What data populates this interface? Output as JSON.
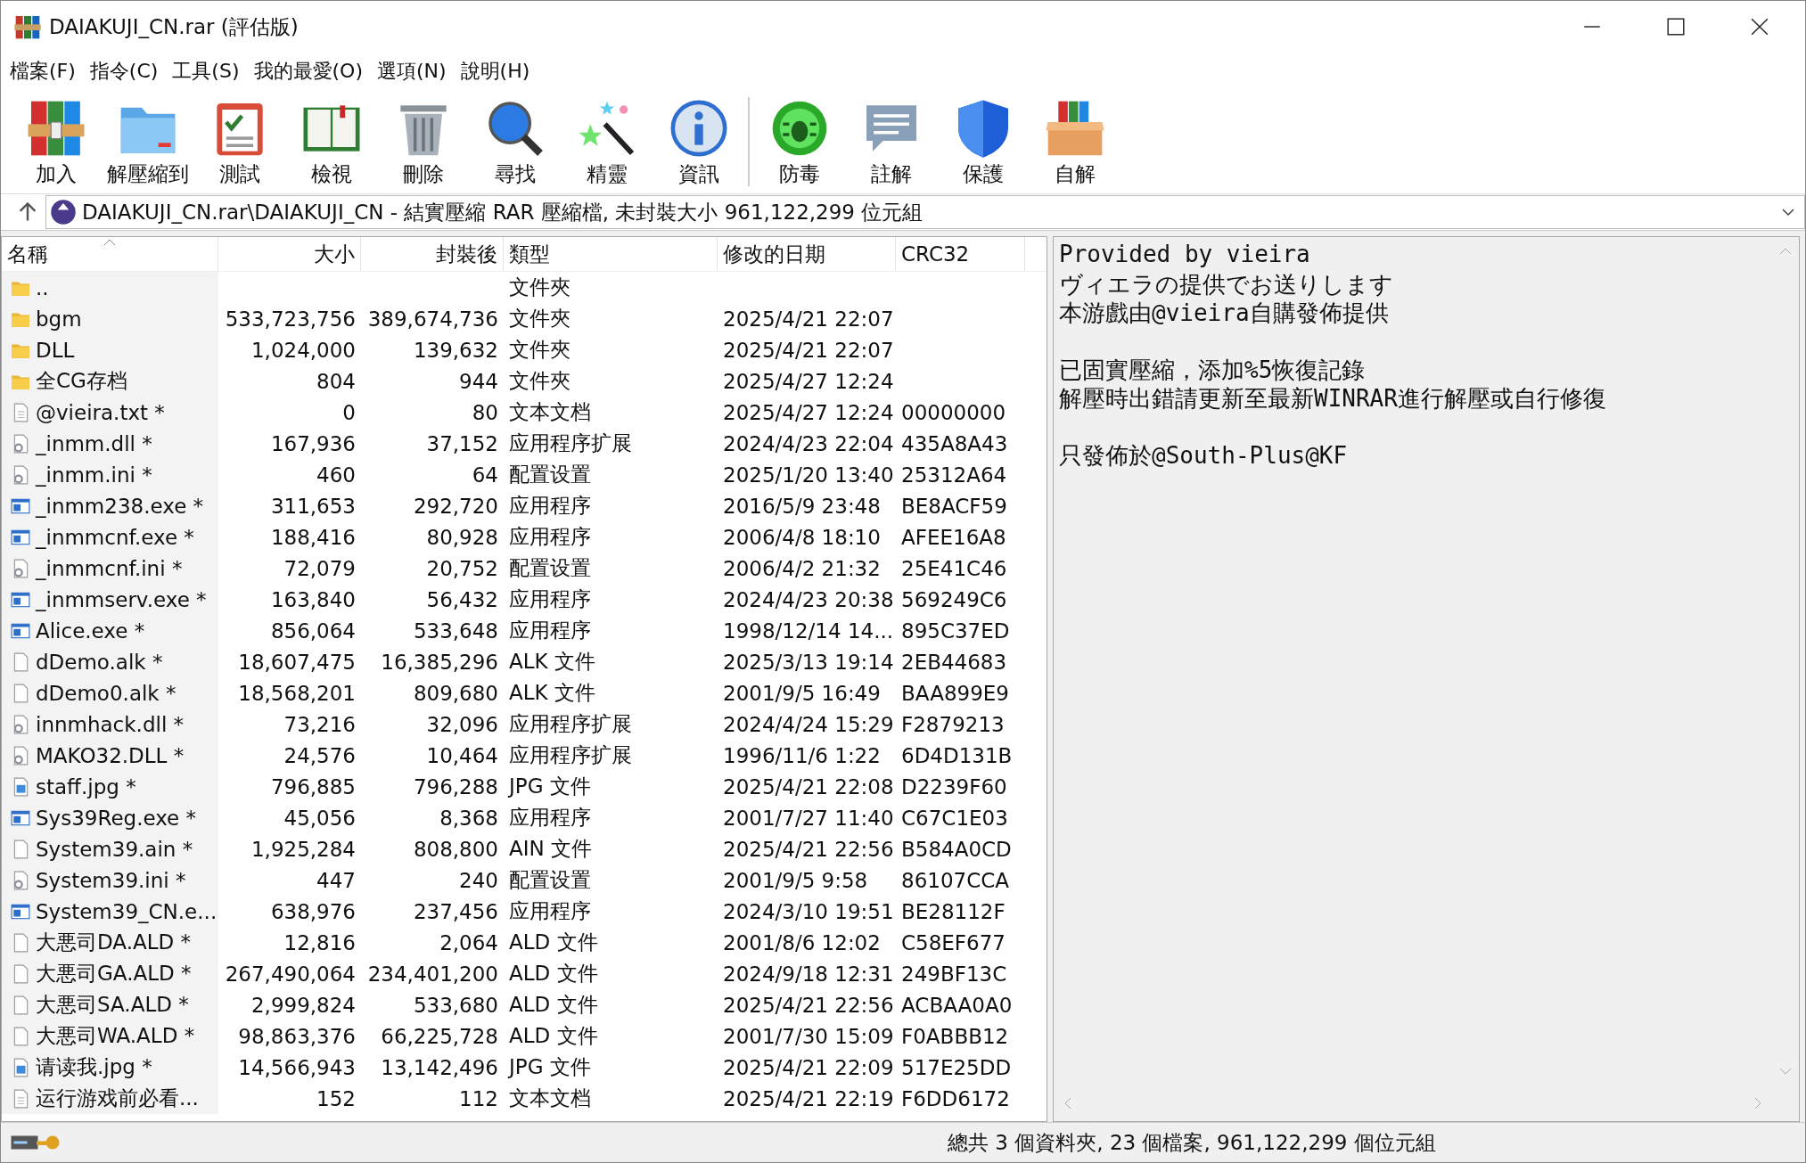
{
  "window": {
    "title": "DAIAKUJI_CN.rar (評估版)"
  },
  "menu": [
    "檔案(F)",
    "指令(C)",
    "工具(S)",
    "我的最愛(O)",
    "選項(N)",
    "說明(H)"
  ],
  "toolbar": [
    {
      "label": "加入",
      "kind": "add"
    },
    {
      "label": "解壓縮到",
      "kind": "extract"
    },
    {
      "label": "測試",
      "kind": "test"
    },
    {
      "label": "檢視",
      "kind": "view"
    },
    {
      "label": "刪除",
      "kind": "delete"
    },
    {
      "label": "尋找",
      "kind": "find"
    },
    {
      "label": "精靈",
      "kind": "wizard"
    },
    {
      "label": "資訊",
      "kind": "info"
    },
    {
      "label": "防毒",
      "kind": "virus",
      "separator_before": true
    },
    {
      "label": "註解",
      "kind": "comment"
    },
    {
      "label": "保護",
      "kind": "protect"
    },
    {
      "label": "自解",
      "kind": "sfx"
    }
  ],
  "address": "DAIAKUJI_CN.rar\\DAIAKUJI_CN - 結實壓縮 RAR 壓縮檔, 未封裝大小 961,122,299 位元組",
  "columns": [
    "名稱",
    "大小",
    "封裝後",
    "類型",
    "修改的日期",
    "CRC32"
  ],
  "rows": [
    {
      "name": "..",
      "type": "文件夾",
      "kind": "folder"
    },
    {
      "name": "bgm",
      "size": "533,723,756",
      "packed": "389,674,736",
      "type": "文件夾",
      "date": "2025/4/21 22:07",
      "kind": "folder"
    },
    {
      "name": "DLL",
      "size": "1,024,000",
      "packed": "139,632",
      "type": "文件夾",
      "date": "2025/4/21 22:07",
      "kind": "folder"
    },
    {
      "name": "全CG存档",
      "size": "804",
      "packed": "944",
      "type": "文件夾",
      "date": "2025/4/27 12:24",
      "kind": "folder"
    },
    {
      "name": "@vieira.txt *",
      "size": "0",
      "packed": "80",
      "type": "文本文档",
      "date": "2025/4/27 12:24",
      "crc": "00000000",
      "kind": "text"
    },
    {
      "name": "_inmm.dll *",
      "size": "167,936",
      "packed": "37,152",
      "type": "应用程序扩展",
      "date": "2024/4/23 22:04",
      "crc": "435A8A43",
      "kind": "dll"
    },
    {
      "name": "_inmm.ini *",
      "size": "460",
      "packed": "64",
      "type": "配置设置",
      "date": "2025/1/20 13:40",
      "crc": "25312A64",
      "kind": "ini"
    },
    {
      "name": "_inmm238.exe *",
      "size": "311,653",
      "packed": "292,720",
      "type": "应用程序",
      "date": "2016/5/9 23:48",
      "crc": "BE8ACF59",
      "kind": "exe"
    },
    {
      "name": "_inmmcnf.exe *",
      "size": "188,416",
      "packed": "80,928",
      "type": "应用程序",
      "date": "2006/4/8 18:10",
      "crc": "AFEE16A8",
      "kind": "exe"
    },
    {
      "name": "_inmmcnf.ini *",
      "size": "72,079",
      "packed": "20,752",
      "type": "配置设置",
      "date": "2006/4/2 21:32",
      "crc": "25E41C46",
      "kind": "ini"
    },
    {
      "name": "_inmmserv.exe *",
      "size": "163,840",
      "packed": "56,432",
      "type": "应用程序",
      "date": "2024/4/23 20:38",
      "crc": "569249C6",
      "kind": "exe"
    },
    {
      "name": "Alice.exe *",
      "size": "856,064",
      "packed": "533,648",
      "type": "应用程序",
      "date": "1998/12/14 14...",
      "crc": "895C37ED",
      "kind": "exe"
    },
    {
      "name": "dDemo.alk *",
      "size": "18,607,475",
      "packed": "16,385,296",
      "type": "ALK 文件",
      "date": "2025/3/13 19:14",
      "crc": "2EB44683",
      "kind": "file"
    },
    {
      "name": "dDemo0.alk *",
      "size": "18,568,201",
      "packed": "809,680",
      "type": "ALK 文件",
      "date": "2001/9/5 16:49",
      "crc": "BAA899E9",
      "kind": "file"
    },
    {
      "name": "innmhack.dll *",
      "size": "73,216",
      "packed": "32,096",
      "type": "应用程序扩展",
      "date": "2024/4/24 15:29",
      "crc": "F2879213",
      "kind": "dll"
    },
    {
      "name": "MAKO32.DLL *",
      "size": "24,576",
      "packed": "10,464",
      "type": "应用程序扩展",
      "date": "1996/11/6 1:22",
      "crc": "6D4D131B",
      "kind": "dll"
    },
    {
      "name": "staff.jpg *",
      "size": "796,885",
      "packed": "796,288",
      "type": "JPG 文件",
      "date": "2025/4/21 22:08",
      "crc": "D2239F60",
      "kind": "image"
    },
    {
      "name": "Sys39Reg.exe *",
      "size": "45,056",
      "packed": "8,368",
      "type": "应用程序",
      "date": "2001/7/27 11:40",
      "crc": "C67C1E03",
      "kind": "exe"
    },
    {
      "name": "System39.ain *",
      "size": "1,925,284",
      "packed": "808,800",
      "type": "AIN 文件",
      "date": "2025/4/21 22:56",
      "crc": "B584A0CD",
      "kind": "file"
    },
    {
      "name": "System39.ini *",
      "size": "447",
      "packed": "240",
      "type": "配置设置",
      "date": "2001/9/5 9:58",
      "crc": "86107CCA",
      "kind": "ini"
    },
    {
      "name": "System39_CN.e...",
      "size": "638,976",
      "packed": "237,456",
      "type": "应用程序",
      "date": "2024/3/10 19:51",
      "crc": "BE28112F",
      "kind": "exe"
    },
    {
      "name": "大悪司DA.ALD *",
      "size": "12,816",
      "packed": "2,064",
      "type": "ALD 文件",
      "date": "2001/8/6 12:02",
      "crc": "C58EF677",
      "kind": "file"
    },
    {
      "name": "大悪司GA.ALD *",
      "size": "267,490,064",
      "packed": "234,401,200",
      "type": "ALD 文件",
      "date": "2024/9/18 12:31",
      "crc": "249BF13C",
      "kind": "file"
    },
    {
      "name": "大悪司SA.ALD *",
      "size": "2,999,824",
      "packed": "533,680",
      "type": "ALD 文件",
      "date": "2025/4/21 22:56",
      "crc": "ACBAA0A0",
      "kind": "file"
    },
    {
      "name": "大悪司WA.ALD *",
      "size": "98,863,376",
      "packed": "66,225,728",
      "type": "ALD 文件",
      "date": "2001/7/30 15:09",
      "crc": "F0ABBB12",
      "kind": "file"
    },
    {
      "name": "请读我.jpg *",
      "size": "14,566,943",
      "packed": "13,142,496",
      "type": "JPG 文件",
      "date": "2025/4/21 22:09",
      "crc": "517E25DD",
      "kind": "image"
    },
    {
      "name": "运行游戏前必看...",
      "size": "152",
      "packed": "112",
      "type": "文本文档",
      "date": "2025/4/21 22:19",
      "crc": "F6DD6172",
      "kind": "text"
    }
  ],
  "comment": [
    [
      "Provided by vieira",
      "ヴィエラの提供でお送りします",
      "本游戲由@vieira自購發佈提供"
    ],
    [
      "已固實壓縮，添加%5恢復記錄",
      "解壓時出錯請更新至最新WINRAR進行解壓或自行修復"
    ],
    [
      "只發佈於@South-Plus@KF"
    ]
  ],
  "status_bar": "總共 3 個資料夾, 23 個檔案, 961,122,299 個位元組"
}
